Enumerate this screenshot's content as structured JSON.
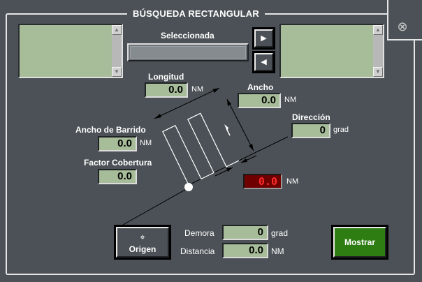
{
  "title": "BÚSQUEDA RECTANGULAR",
  "close_icon": "close-circle-x-icon",
  "selected_label": "Seleccionada",
  "arrows": {
    "right": "▶",
    "left": "◀"
  },
  "longitud": {
    "label": "Longitud",
    "value": "0.0",
    "unit": "NM"
  },
  "ancho": {
    "label": "Ancho",
    "value": "0.0",
    "unit": "NM"
  },
  "direccion": {
    "label": "Dirección",
    "value": "0",
    "unit": "grad"
  },
  "ancho_barrido": {
    "label": "Ancho de Barrido",
    "value": "0.0",
    "unit": "NM"
  },
  "factor_cobertura": {
    "label": "Factor Cobertura",
    "value": "0.0"
  },
  "red_display": {
    "value": "0.0",
    "unit": "NM"
  },
  "origen_button": {
    "label": "Origen",
    "icon": "crosshair-icon"
  },
  "demora": {
    "label": "Demora",
    "value": "0",
    "unit": "grad"
  },
  "distancia": {
    "label": "Distancia",
    "value": "0.0",
    "unit": "NM"
  },
  "mostrar_button": {
    "label": "Mostrar"
  },
  "colors": {
    "panel": "#4b5156",
    "field": "#a7bd9a",
    "mostrar": "#2e7d12",
    "red_display_bg": "#6e0000",
    "red_display_text": "#ff2a2a"
  }
}
